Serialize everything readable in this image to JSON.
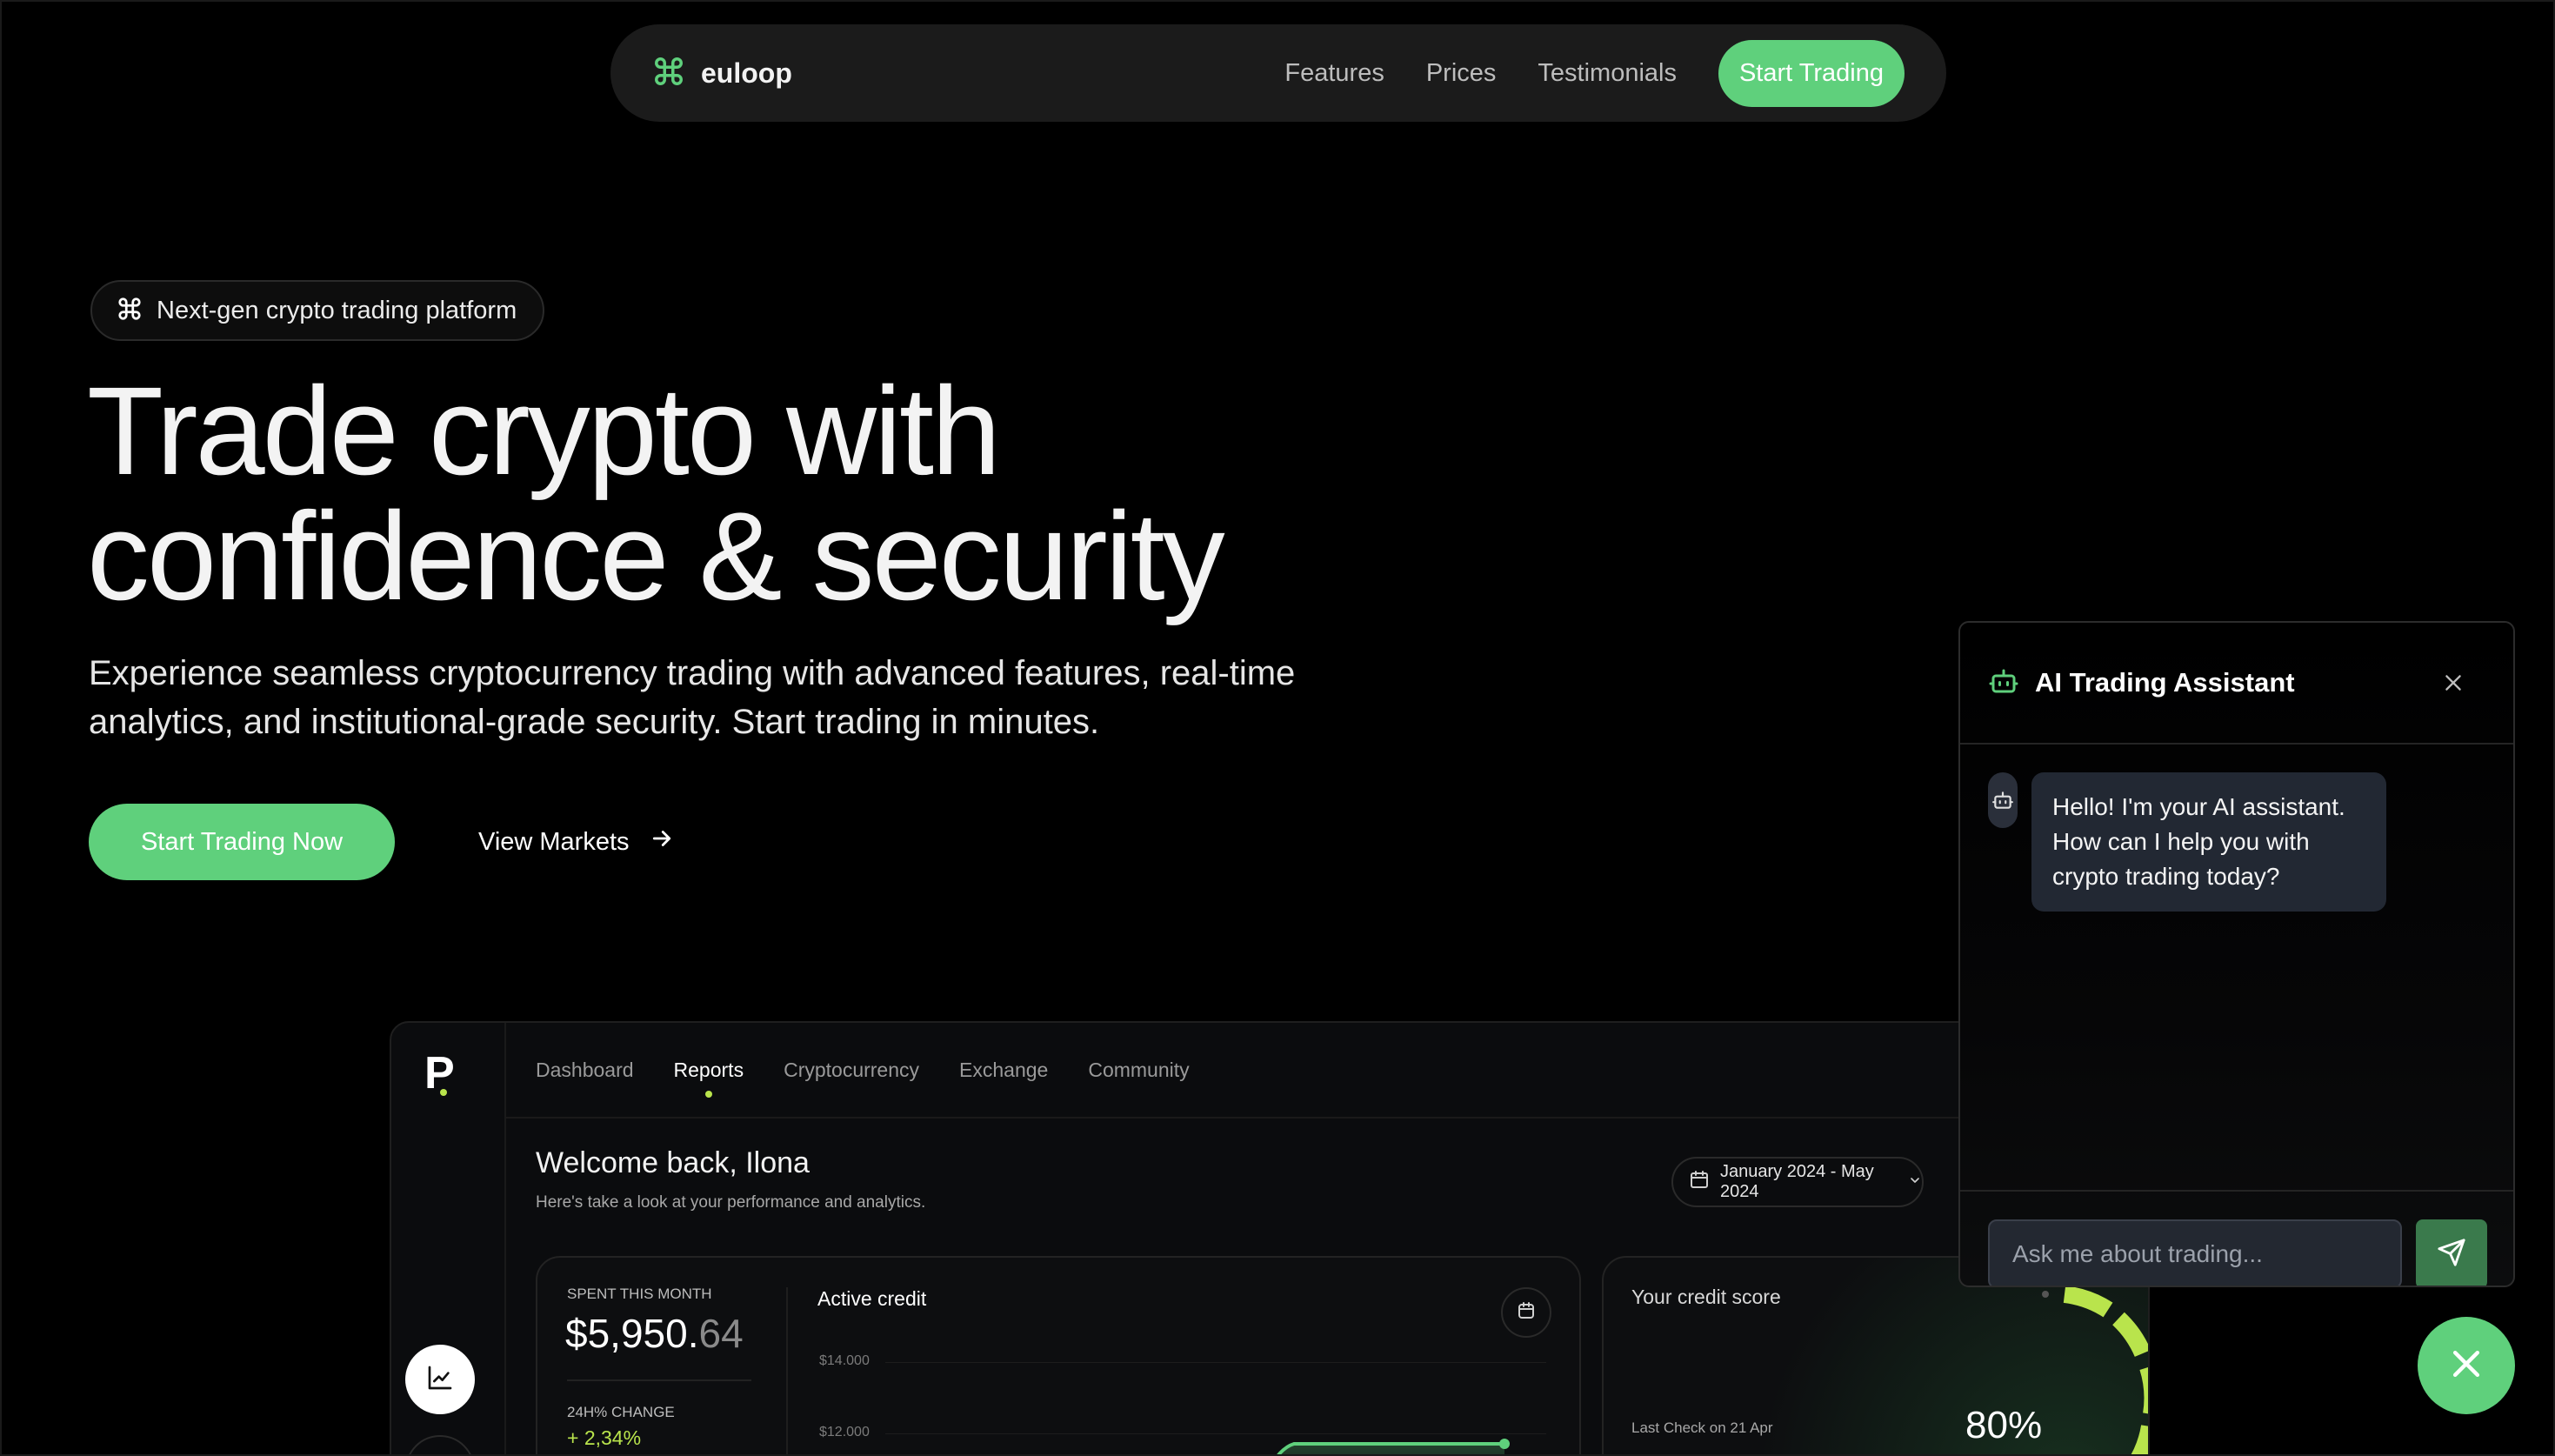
{
  "nav": {
    "brand": "euloop",
    "links": [
      "Features",
      "Prices",
      "Testimonials"
    ],
    "cta": "Start Trading"
  },
  "hero": {
    "pill": "Next-gen crypto trading platform",
    "title_line1": "Trade crypto with",
    "title_line2": "confidence & security",
    "subtitle": "Experience seamless cryptocurrency trading with advanced features, real-time analytics, and institutional-grade security. Start trading in minutes.",
    "primary_cta": "Start Trading Now",
    "secondary_cta": "View Markets"
  },
  "dashboard": {
    "logo": "P",
    "tabs": [
      "Dashboard",
      "Reports",
      "Cryptocurrency",
      "Exchange",
      "Community"
    ],
    "active_tab": "Reports",
    "welcome": "Welcome back, Ilona",
    "welcome_sub": "Here's  take a look at your performance and analytics.",
    "date_range": "January 2024 - May 2024",
    "spent_label": "SPENT THIS MONTH",
    "spent_main": "$5,950.",
    "spent_cents": "64",
    "change_label": "24H% CHANGE",
    "change_value": "+ 2,34%",
    "active_credit_title": "Active credit",
    "active_credit_ticks": [
      "$14.000",
      "$12.000"
    ],
    "credit_score_title": "Your credit score",
    "credit_score_sub": "Last Check on 21 Apr",
    "credit_score_value": "80%",
    "credit_score_fraction": 0.8
  },
  "chat": {
    "title": "AI Trading Assistant",
    "message": "Hello! I'm your AI assistant. How can I help you with crypto trading today?",
    "input_placeholder": "Ask me about trading..."
  },
  "colors": {
    "accent": "#5fd07c",
    "lime": "#b9e44c",
    "background": "#000000"
  },
  "icons": {
    "brand": "command-icon",
    "pill": "command-icon",
    "secondary_cta": "arrow-right-icon",
    "chat_title": "robot-icon",
    "chat_close": "close-icon",
    "send": "send-icon",
    "fab": "close-icon",
    "dash_side": "chart-line-icon",
    "date": "calendar-icon"
  }
}
